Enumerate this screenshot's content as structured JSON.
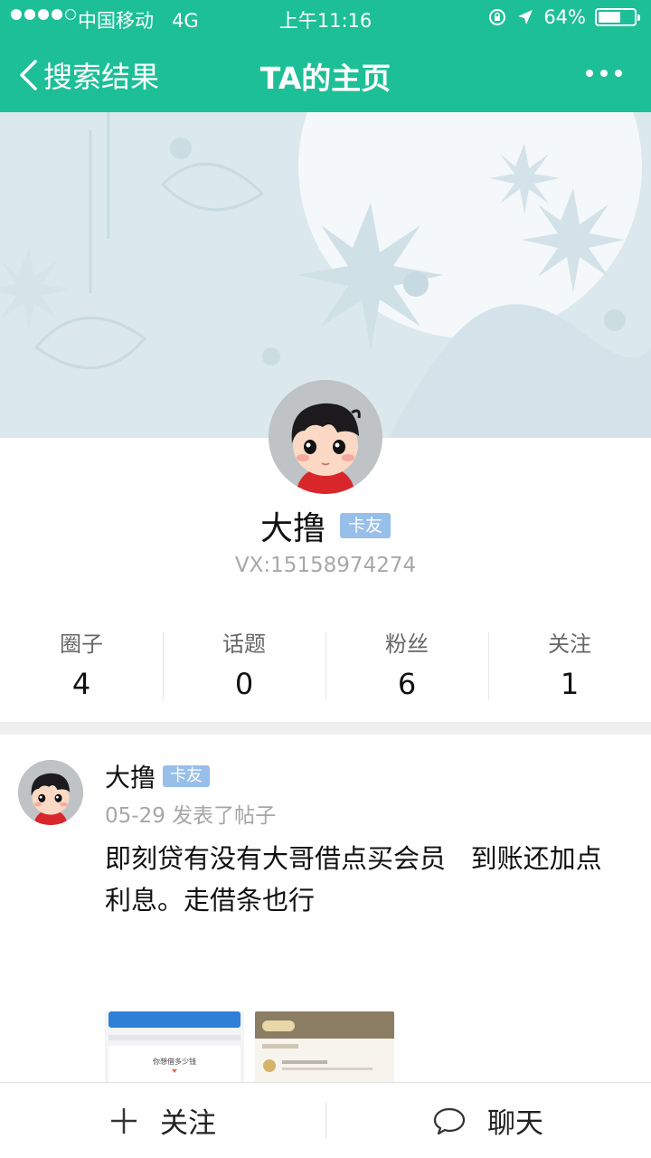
{
  "status_bar": {
    "carrier": "中国移动",
    "network": "4G",
    "time": "上午11:16",
    "battery_text": "64%",
    "battery_level": 0.64
  },
  "nav": {
    "back_label": "搜索结果",
    "title": "TA的主页"
  },
  "profile": {
    "name": "大撸",
    "badge": "卡友",
    "vx": "VX:15158974274"
  },
  "stats": [
    {
      "label": "圈子",
      "value": "4"
    },
    {
      "label": "话题",
      "value": "0"
    },
    {
      "label": "粉丝",
      "value": "6"
    },
    {
      "label": "关注",
      "value": "1"
    }
  ],
  "post": {
    "author": "大撸",
    "badge": "卡友",
    "meta": "05-29 发表了帖子",
    "text": "即刻贷有没有大哥借点买会员   到账还加点利息。走借条也行",
    "thumb1_text": "你想借多少钱"
  },
  "bottom": {
    "follow_label": "关注",
    "chat_label": "聊天"
  },
  "colors": {
    "brand": "#1dbf97",
    "badge": "#98bfe9",
    "banner": "#dbe8ed"
  }
}
